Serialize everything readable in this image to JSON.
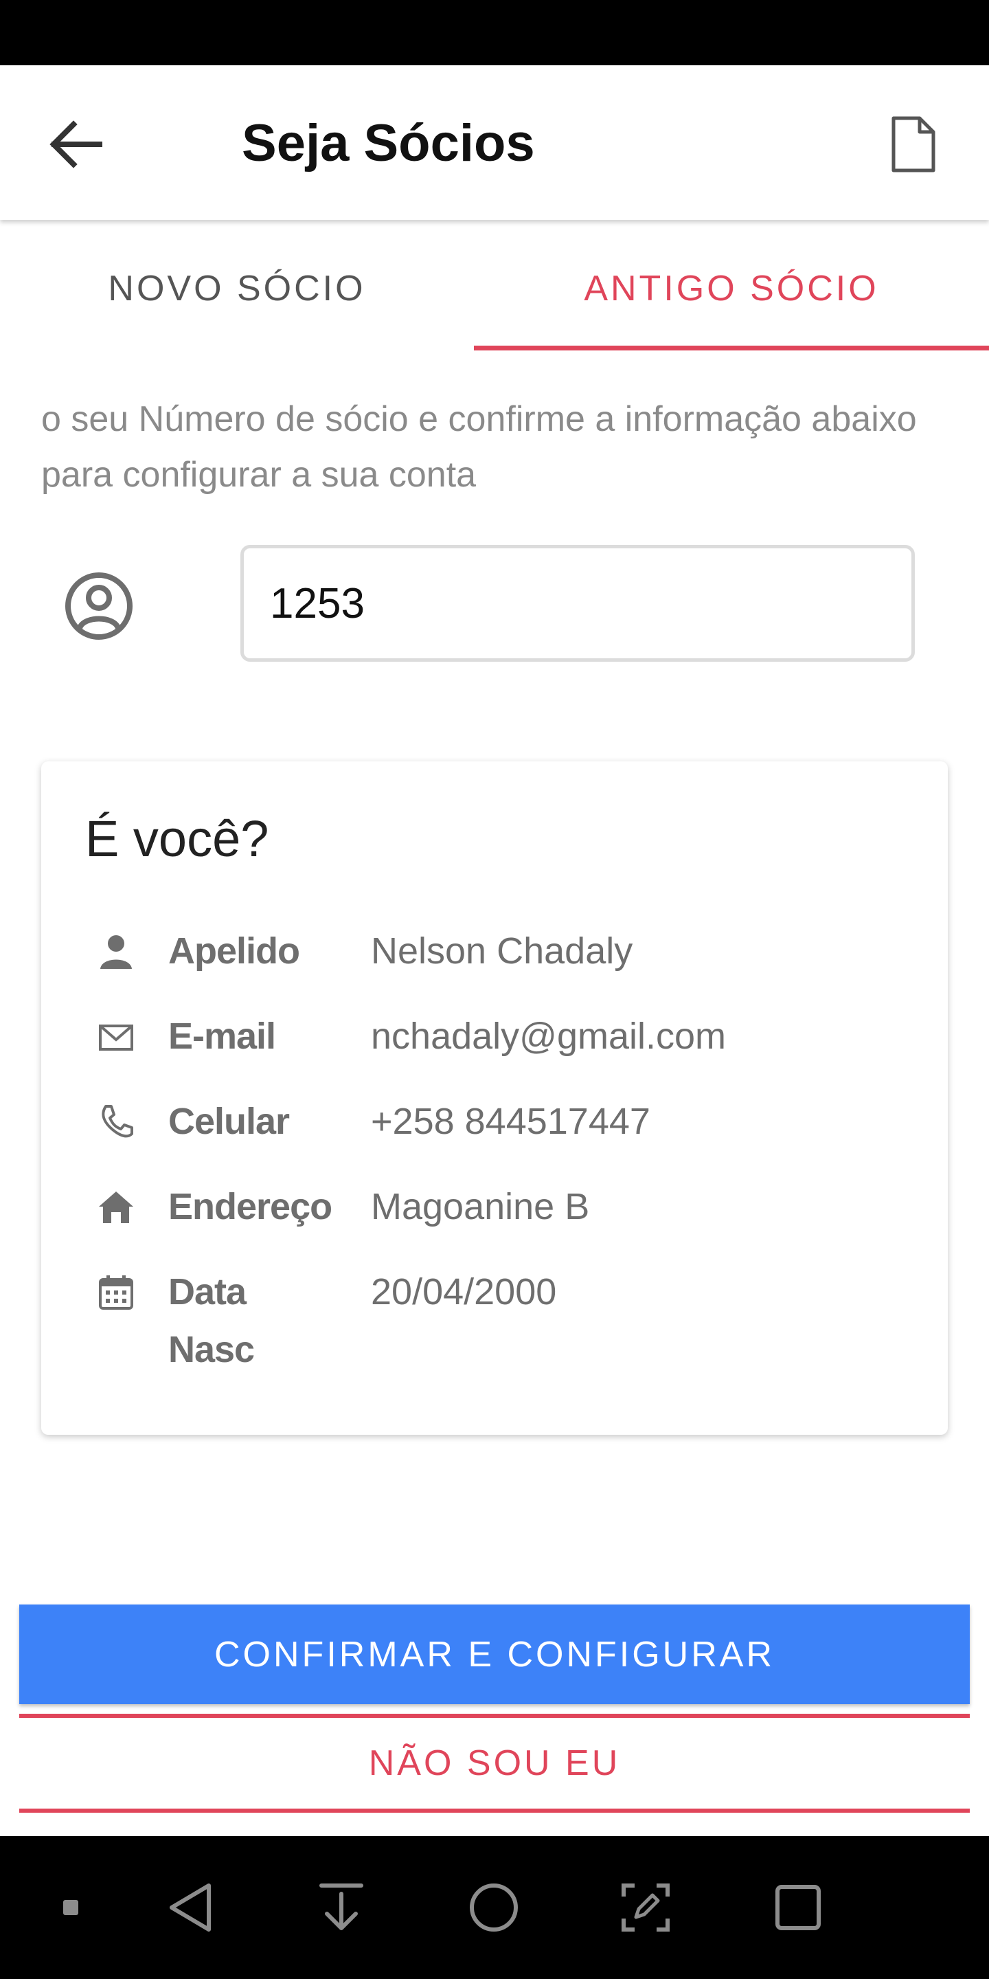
{
  "appbar": {
    "title": "Seja Sócios",
    "back_icon": "arrow-left-icon",
    "action_icon": "document-icon"
  },
  "tabs": [
    {
      "label": "NOVO SÓCIO",
      "active": false
    },
    {
      "label": "ANTIGO SÓCIO",
      "active": true
    }
  ],
  "instructions": "o seu Número de sócio e confirme a informação abaixo para configurar a sua conta",
  "member_number": {
    "value": "1253",
    "icon": "user-circle-icon"
  },
  "card": {
    "title": "É você?",
    "rows": [
      {
        "icon": "person-icon",
        "label": "Apelido",
        "value": "Nelson Chadaly"
      },
      {
        "icon": "mail-icon",
        "label": "E-mail",
        "value": "nchadaly@gmail.com"
      },
      {
        "icon": "phone-icon",
        "label": "Celular",
        "value": "+258 844517447"
      },
      {
        "icon": "home-icon",
        "label": "Endereço",
        "value": "Magoanine B"
      },
      {
        "icon": "calendar-icon",
        "label": "Data Nasc",
        "value": "20/04/2000"
      }
    ]
  },
  "buttons": {
    "confirm": "CONFIRMAR E CONFIGURAR",
    "not_me": "NÃO SOU EU"
  },
  "colors": {
    "accent": "#e0455a",
    "primary": "#3d82f8",
    "text_secondary": "#6e6e6e"
  },
  "system_nav": [
    "square-dot-icon",
    "back-triangle-icon",
    "download-icon",
    "home-circle-icon",
    "screenshot-edit-icon",
    "recents-square-icon"
  ]
}
